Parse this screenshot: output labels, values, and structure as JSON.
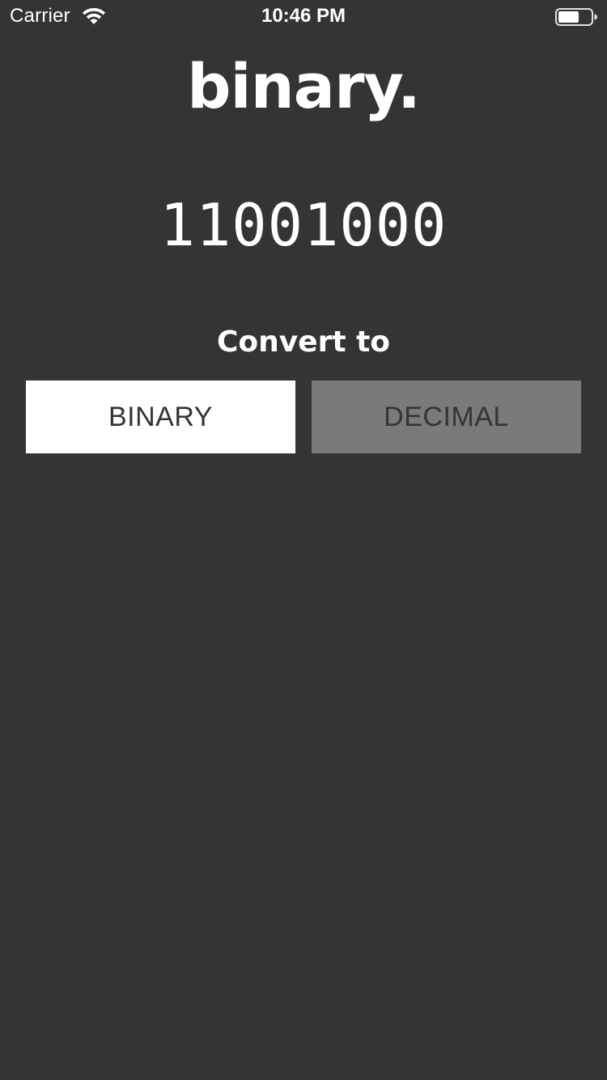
{
  "status_bar": {
    "carrier": "Carrier",
    "time": "10:46 PM",
    "wifi_icon": "wifi-icon",
    "battery_icon": "battery-icon"
  },
  "app": {
    "title": "binary.",
    "value": "11001000",
    "convert_label": "Convert to"
  },
  "buttons": {
    "binary_label": "BINARY",
    "decimal_label": "DECIMAL"
  },
  "colors": {
    "background": "#343434",
    "active_button": "#ffffff",
    "inactive_button": "#7a7a7a",
    "text_light": "#ffffff",
    "text_dark": "#343434"
  }
}
